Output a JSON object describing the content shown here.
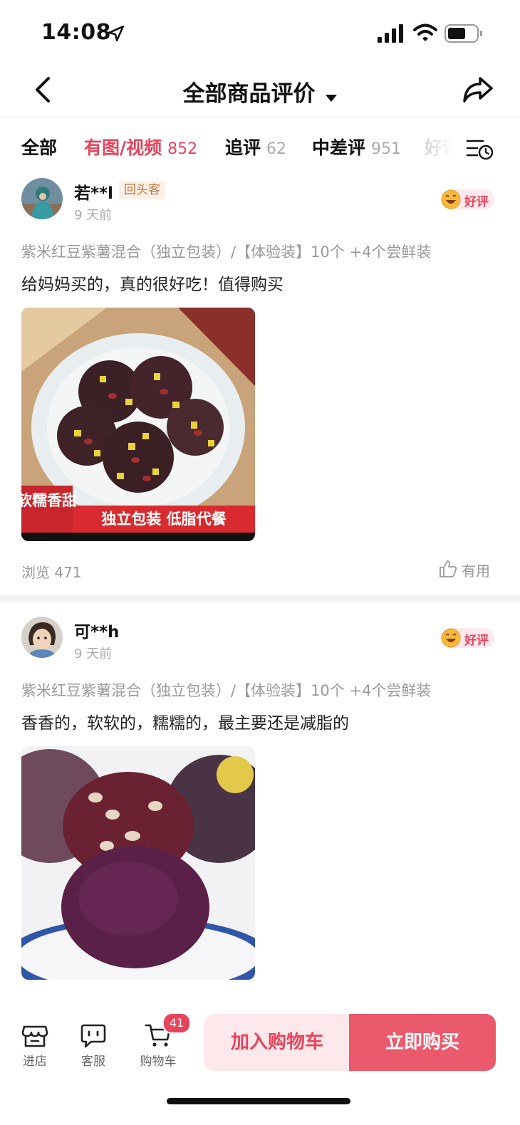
{
  "status_bar": {
    "time": "14:08"
  },
  "nav": {
    "title": "全部商品评价"
  },
  "tabs": [
    {
      "label": "全部",
      "count": ""
    },
    {
      "label": "有图/视频",
      "count": "852"
    },
    {
      "label": "追评",
      "count": "62"
    },
    {
      "label": "中差评",
      "count": "951"
    },
    {
      "label": "好评",
      "count": ""
    }
  ],
  "reviews": [
    {
      "username": "若**l",
      "badge": "回头客",
      "time_ago": "9 天前",
      "rating": "好评",
      "variant": "紫米红豆紫薯混合（独立包装）/【体验装】10个 +4个尝鲜装",
      "comment": "给妈妈买的，真的很好吃！值得购买",
      "photo_text": {
        "side": "软糯香甜",
        "banner": "独立包装 低脂代餐"
      },
      "views": "浏览 471",
      "helpful": "有用"
    },
    {
      "username": "可**h",
      "time_ago": "9 天前",
      "rating": "好评",
      "variant": "紫米红豆紫薯混合（独立包装）/【体验装】10个 +4个尝鲜装",
      "comment": "香香的，软软的，糯糯的，最主要还是减脂的"
    }
  ],
  "bottom_bar": {
    "store": "进店",
    "service": "客服",
    "cart": "购物车",
    "cart_count": "41",
    "add_to_cart": "加入购物车",
    "buy_now": "立即购买"
  },
  "colors": {
    "accent": "#e8435a",
    "buy_button": "#ea5a6c",
    "add_button_bg": "#fde8ec"
  }
}
